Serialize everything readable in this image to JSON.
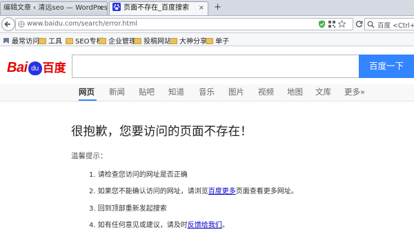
{
  "tabs": [
    {
      "label": "编辑文章 ‹ 清远seo — WordPress",
      "close": "×",
      "active": false
    },
    {
      "label": "页面不存在_百度搜索",
      "close": "×",
      "active": true
    }
  ],
  "new_tab": "+",
  "url": "www.baidu.com/search/error.html",
  "search_placeholder": "百度 <Ctrl+K>",
  "bookmarks": [
    "最常访问",
    "工具",
    "SEO专栏",
    "企业管理",
    "投稿网站",
    "大神分享",
    "单子"
  ],
  "baidu": {
    "logo_prefix": "Bai",
    "logo_paw": "du",
    "logo_suffix": "百度",
    "search_button": "百度一下"
  },
  "nav_tabs": [
    "网页",
    "新闻",
    "贴吧",
    "知道",
    "音乐",
    "图片",
    "视频",
    "地图",
    "文库",
    "更多»"
  ],
  "selected_nav_tab": "网页",
  "error_title": "很抱歉，您要访问的页面不存在！",
  "tips_label": "温馨提示：",
  "tips": {
    "t1": "1. 请检查您访问的网址是否正确",
    "t2_before": "2. 如果您不能确认访问的网址，请浏览",
    "t2_link": "百度更多",
    "t2_after": "页面查看更多网址。",
    "t3": "3. 回到顶部重新发起搜索",
    "t4_before": "4. 如有任何意见或建议，请及时",
    "t4_link": "反馈给我们",
    "t4_after": "。"
  },
  "colors": {
    "baidu_red": "#e10602",
    "baidu_blue": "#2932e1",
    "search_button": "#3385ff",
    "link": "#0000cc",
    "tab_underline": "#3388ff"
  },
  "icons": [
    "wordpress-icon",
    "baidu-paw-icon",
    "back-arrow-icon",
    "globe-icon",
    "shield-icon",
    "qr-code-icon",
    "star-icon",
    "reload-icon",
    "search-icon",
    "folder-icon"
  ]
}
